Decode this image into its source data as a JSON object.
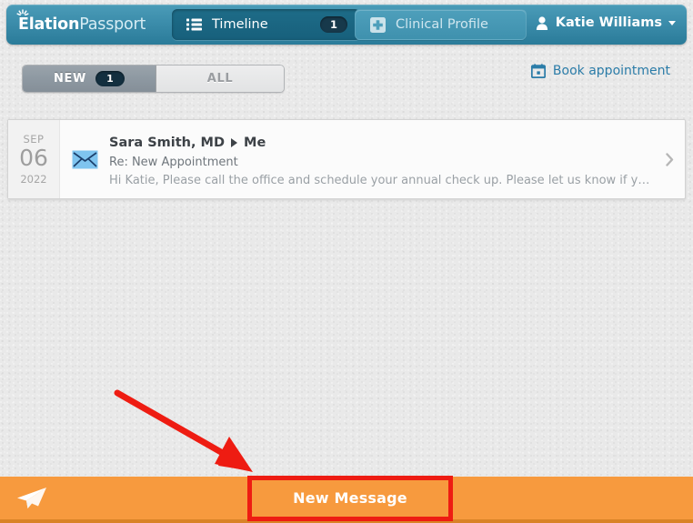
{
  "app": {
    "brand_bold": "Elation",
    "brand_light": "Passport",
    "brand_icon": "starburst-icon"
  },
  "header": {
    "tabs": [
      {
        "id": "timeline",
        "label": "Timeline",
        "badge": "1",
        "icon": "list-icon",
        "active": true
      },
      {
        "id": "clinical-profile",
        "label": "Clinical Profile",
        "icon": "medical-cross-icon",
        "active": false
      }
    ],
    "user": {
      "name": "Katie Williams",
      "avatar_icon": "person-icon",
      "caret_icon": "caret-down-icon"
    }
  },
  "toolbar": {
    "filters": [
      {
        "id": "new",
        "label": "NEW",
        "badge": "1",
        "selected": true
      },
      {
        "id": "all",
        "label": "ALL",
        "selected": false
      }
    ],
    "book_appointment": {
      "label": "Book appointment",
      "icon": "calendar-icon"
    }
  },
  "messages": [
    {
      "date": {
        "month": "SEP",
        "day": "06",
        "year": "2022"
      },
      "status_icon": "envelope-icon",
      "from": "Sara Smith, MD",
      "to": "Me",
      "arrow_icon": "triangle-right-icon",
      "subject": "Re: New Appointment",
      "preview": "Hi Katie, Please call the office and schedule your annual check up. Please let us know if you ...",
      "chevron_icon": "chevron-right-icon"
    }
  ],
  "footer": {
    "send_icon": "paper-plane-icon",
    "new_message_label": "New Message"
  },
  "annotations": {
    "arrow": {
      "icon": "red-arrow-annotation",
      "color": "#ee1c12"
    },
    "highlight": {
      "target": "new-message-button",
      "color": "#ee1c12"
    }
  },
  "colors": {
    "header_teal": "#3e8fad",
    "header_tab_active": "#17607c",
    "link_blue": "#2b7ca8",
    "accent_orange": "#f79a3e",
    "accent_orange_dark": "#d98327",
    "annotation_red": "#ee1c12",
    "page_bg": "#e9e9e9"
  }
}
